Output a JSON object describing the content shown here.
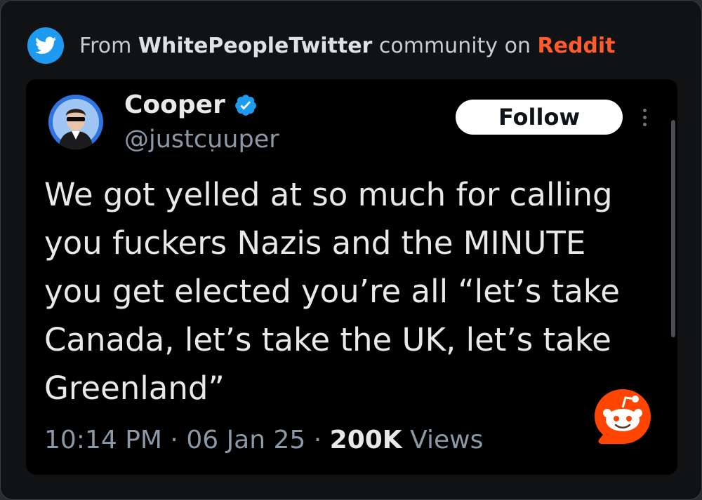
{
  "header": {
    "prefix": "From ",
    "community": "WhitePeopleTwitter",
    "middle": " community on ",
    "platform": "Reddit",
    "twitter_icon": "twitter-bird-icon"
  },
  "tweet": {
    "display_name": "Cooper",
    "handle": "@justcuuper",
    "follow_label": "Follow",
    "text": "We got yelled at so much for calling\nyou fuckers Nazis and the MINUTE\nyou get elected you’re all “let’s take\nCanada, let’s take the UK, let’s take\nGreenland”",
    "time": "10:14 PM",
    "sep1": " · ",
    "date": "06 Jan 25",
    "sep2": " · ",
    "views_count": "200K",
    "views_label": " Views"
  },
  "colors": {
    "accent_blue": "#1d9bf0",
    "reddit_orange": "#ff5c2a",
    "background": "#000000"
  }
}
